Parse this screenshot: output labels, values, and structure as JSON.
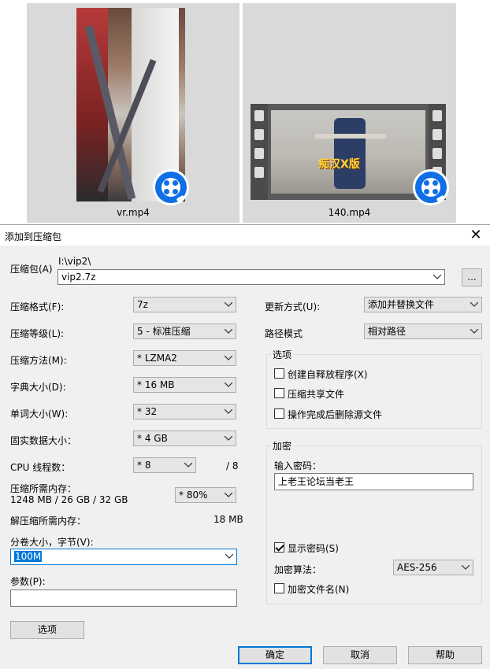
{
  "files": [
    {
      "name": "vr.mp4"
    },
    {
      "name": "140.mp4",
      "overlay_text": "痴汉X版"
    }
  ],
  "dialog": {
    "title": "添加到压缩包",
    "archive_label": "压缩包(A)",
    "archive_dir": "I:\\vip2\\",
    "archive_name": "vip2.7z",
    "browse_label": "...",
    "format_label": "压缩格式(F):",
    "format_value": "7z",
    "level_label": "压缩等级(L):",
    "level_value": "5 - 标准压缩",
    "method_label": "压缩方法(M):",
    "method_value": "*  LZMA2",
    "dict_label": "字典大小(D):",
    "dict_value": "*  16 MB",
    "word_label": "单词大小(W):",
    "word_value": "*  32",
    "solid_label": "固实数据大小：",
    "solid_value": "*  4 GB",
    "cpu_label": "CPU 线程数：",
    "cpu_value": "*  8",
    "cpu_total": "/ 8",
    "mem_label": "压缩所需内存：",
    "mem_value": "1248 MB / 26 GB / 32 GB",
    "mem_percent": "*  80%",
    "decomp_label": "解压缩所需内存：",
    "decomp_value": "18 MB",
    "volume_label": "分卷大小，字节(V):",
    "volume_value": "100M",
    "params_label": "参数(P):",
    "params_value": "",
    "options_button": "选项",
    "update_label": "更新方式(U):",
    "update_value": "添加并替换文件",
    "path_label": "路径模式",
    "path_value": "相对路径",
    "options_group": "选项",
    "opt_sfx": "创建自释放程序(X)",
    "opt_shared": "压缩共享文件",
    "opt_delete": "操作完成后删除源文件",
    "encrypt_group": "加密",
    "password_label": "输入密码：",
    "password_value": "上老王论坛当老王",
    "show_password": "显示密码(S)",
    "enc_method_label": "加密算法：",
    "enc_method_value": "AES-256",
    "encrypt_names": "加密文件名(N)",
    "ok": "确定",
    "cancel": "取消",
    "help": "帮助"
  }
}
